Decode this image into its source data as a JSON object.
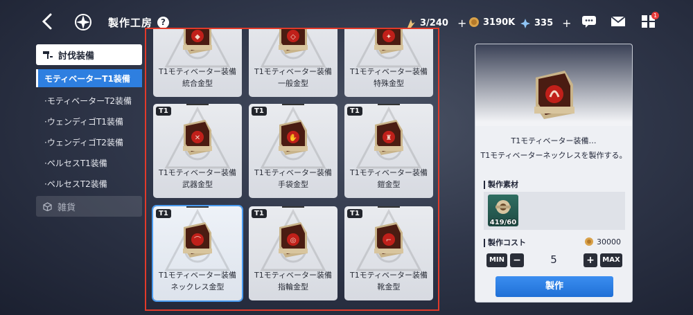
{
  "header": {
    "title": "製作工房",
    "help": "?",
    "stamina": "3/240",
    "gold": "3190K",
    "gems": "335",
    "plus": "+",
    "badge": "1"
  },
  "sidebar": {
    "category": "討伐装備",
    "items": [
      {
        "label": "モティベーターT1装備",
        "selected": true
      },
      {
        "label": "·モティベーターT2装備",
        "selected": false
      },
      {
        "label": "·ウェンディゴT1装備",
        "selected": false
      },
      {
        "label": "·ウェンディゴT2装備",
        "selected": false
      },
      {
        "label": "·ペルセスT1装備",
        "selected": false
      },
      {
        "label": "·ペルセスT2装備",
        "selected": false
      }
    ],
    "misc": "雑貨"
  },
  "grid": {
    "cards": [
      {
        "tag": "",
        "line1": "T1モティベーター装備",
        "line2": "統合金型"
      },
      {
        "tag": "",
        "line1": "T1モティベーター装備",
        "line2": "一般金型"
      },
      {
        "tag": "",
        "line1": "T1モティベーター装備",
        "line2": "特殊金型"
      },
      {
        "tag": "T1",
        "line1": "T1モティベーター装備",
        "line2": "武器金型"
      },
      {
        "tag": "T1",
        "line1": "T1モティベーター装備",
        "line2": "手袋金型"
      },
      {
        "tag": "T1",
        "line1": "T1モティベーター装備",
        "line2": "鎧金型"
      },
      {
        "tag": "T1",
        "line1": "T1モティベーター装備",
        "line2": "ネックレス金型"
      },
      {
        "tag": "T1",
        "line1": "T1モティベーター装備",
        "line2": "指輪金型"
      },
      {
        "tag": "T1",
        "line1": "T1モティベーター装備",
        "line2": "靴金型"
      }
    ]
  },
  "detail": {
    "name": "T1モティベーター装備…",
    "desc": "T1モティベーターネックレスを製作する。",
    "materials_label": "製作素材",
    "material_count": "419/60",
    "cost_label": "製作コスト",
    "cost_value": "30000",
    "min": "MIN",
    "max": "MAX",
    "minus": "−",
    "plus": "+",
    "quantity": "5",
    "make": "製作"
  },
  "colors": {
    "accent": "#2e7fe0",
    "highlight_border": "#e23a2a"
  }
}
